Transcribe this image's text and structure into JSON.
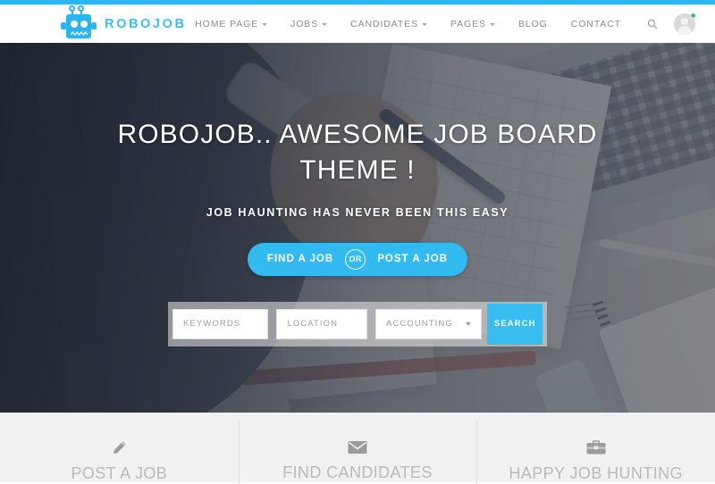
{
  "theme": {
    "accent": "#29b6f0",
    "button_blue": "#39bdf0",
    "feature_bg": "#f1f1f1",
    "nav_text": "#8b8b8b"
  },
  "top_accent": {
    "color": "#29b6f0"
  },
  "header": {
    "logo": {
      "icon": "robot-icon",
      "brand_name": "ROBOJOB"
    },
    "nav_items": [
      {
        "label": "HOME PAGE",
        "has_dropdown": true
      },
      {
        "label": "JOBS",
        "has_dropdown": true
      },
      {
        "label": "CANDIDATES",
        "has_dropdown": true
      },
      {
        "label": "PAGES",
        "has_dropdown": true
      },
      {
        "label": "BLOG",
        "has_dropdown": false
      },
      {
        "label": "CONTACT",
        "has_dropdown": false
      }
    ],
    "search_icon": "search-icon",
    "avatar": {
      "icon": "user-avatar-icon",
      "status": "online"
    }
  },
  "hero": {
    "title": "ROBOJOB.. AWESOME JOB BOARD THEME !",
    "subtitle": "JOB HAUNTING HAS NEVER BEEN THIS EASY",
    "cta": {
      "left_label": "FIND A JOB",
      "divider_label": "OR",
      "right_label": "POST A JOB"
    },
    "search": {
      "keywords_placeholder": "KEYWORDS",
      "keywords_value": "",
      "location_placeholder": "LOCATION",
      "location_value": "",
      "category_selected": "ACCOUNTING",
      "search_button": "SEARCH"
    }
  },
  "features": [
    {
      "icon": "pencil-icon",
      "title": "POST A JOB"
    },
    {
      "icon": "envelope-icon",
      "title": "FIND CANDIDATES"
    },
    {
      "icon": "briefcase-icon",
      "title": "HAPPY JOB HUNTING"
    }
  ]
}
